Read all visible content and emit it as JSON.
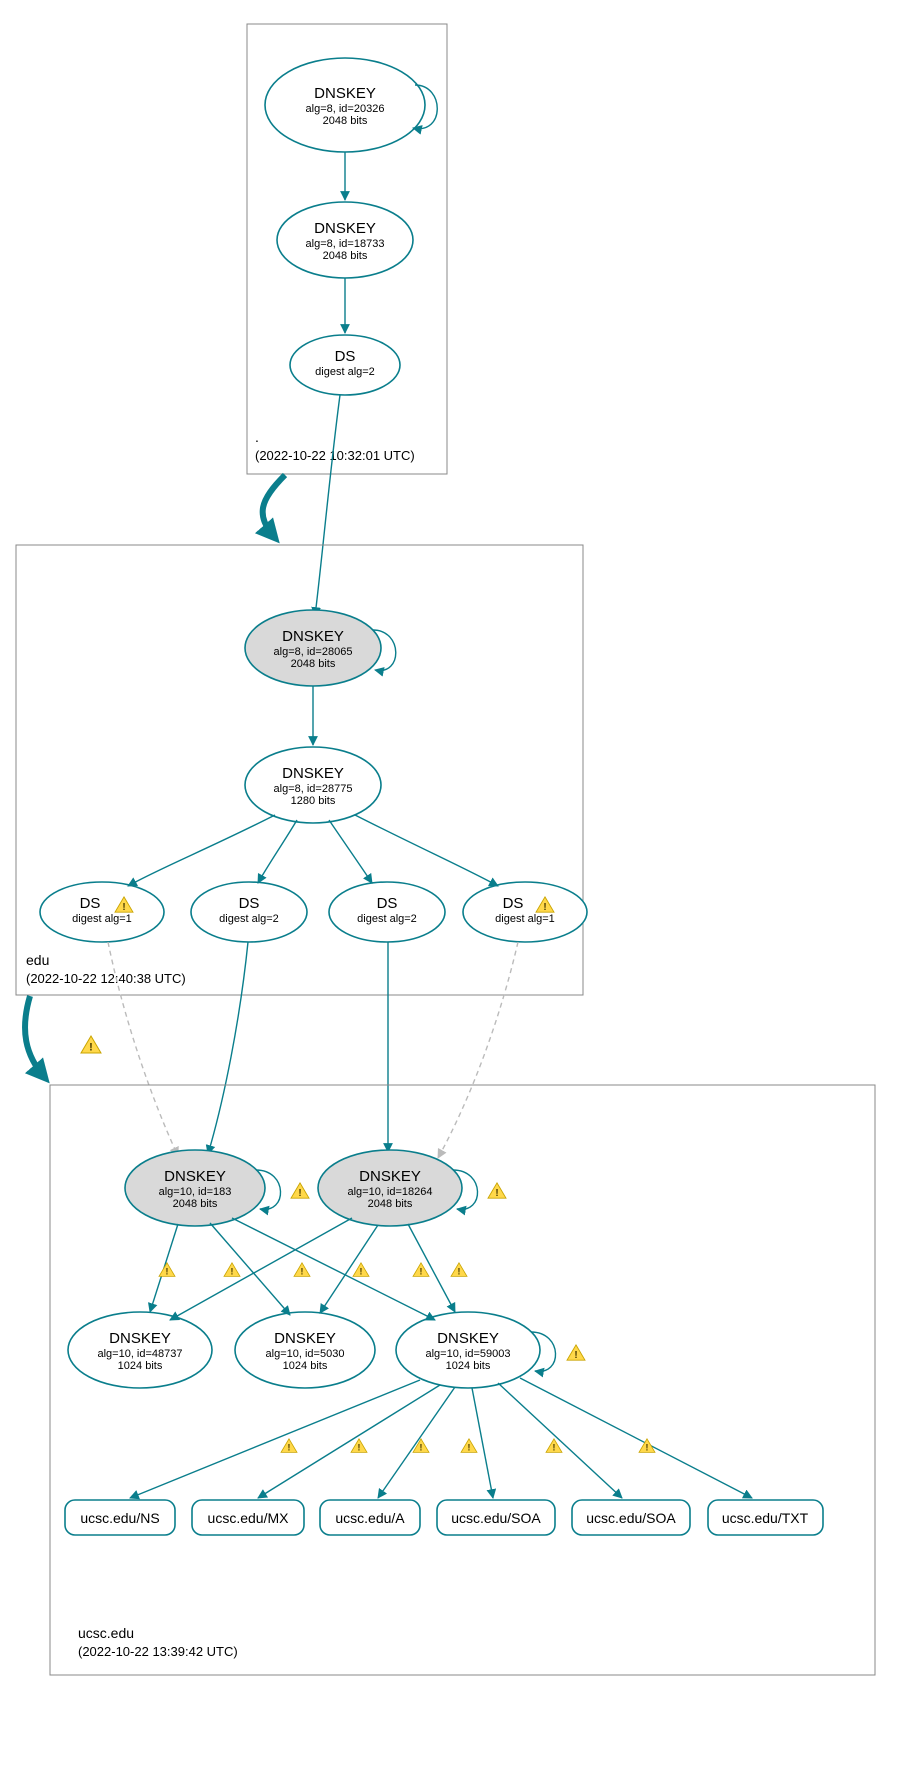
{
  "chart_data": {
    "type": "dnssec-auth-graph",
    "zones": [
      {
        "id": "root",
        "label": ".",
        "timestamp": "(2022-10-22 10:32:01 UTC)"
      },
      {
        "id": "edu",
        "label": "edu",
        "timestamp": "(2022-10-22 12:40:38 UTC)"
      },
      {
        "id": "ucsc",
        "label": "ucsc.edu",
        "timestamp": "(2022-10-22 13:39:42 UTC)"
      }
    ],
    "nodes": {
      "root_ksk": {
        "title": "DNSKEY",
        "line1": "alg=8, id=20326",
        "line2": "2048 bits"
      },
      "root_zsk": {
        "title": "DNSKEY",
        "line1": "alg=8, id=18733",
        "line2": "2048 bits"
      },
      "root_ds": {
        "title": "DS",
        "line1": "digest alg=2",
        "line2": ""
      },
      "edu_ksk": {
        "title": "DNSKEY",
        "line1": "alg=8, id=28065",
        "line2": "2048 bits"
      },
      "edu_zsk": {
        "title": "DNSKEY",
        "line1": "alg=8, id=28775",
        "line2": "1280 bits"
      },
      "edu_ds1": {
        "title": "DS",
        "line1": "digest alg=1",
        "line2": ""
      },
      "edu_ds2": {
        "title": "DS",
        "line1": "digest alg=2",
        "line2": ""
      },
      "edu_ds3": {
        "title": "DS",
        "line1": "digest alg=2",
        "line2": ""
      },
      "edu_ds4": {
        "title": "DS",
        "line1": "digest alg=1",
        "line2": ""
      },
      "ucsc_ksk1": {
        "title": "DNSKEY",
        "line1": "alg=10, id=183",
        "line2": "2048 bits"
      },
      "ucsc_ksk2": {
        "title": "DNSKEY",
        "line1": "alg=10, id=18264",
        "line2": "2048 bits"
      },
      "ucsc_zsk1": {
        "title": "DNSKEY",
        "line1": "alg=10, id=48737",
        "line2": "1024 bits"
      },
      "ucsc_zsk2": {
        "title": "DNSKEY",
        "line1": "alg=10, id=5030",
        "line2": "1024 bits"
      },
      "ucsc_zsk3": {
        "title": "DNSKEY",
        "line1": "alg=10, id=59003",
        "line2": "1024 bits"
      },
      "rr_ns": {
        "label": "ucsc.edu/NS"
      },
      "rr_mx": {
        "label": "ucsc.edu/MX"
      },
      "rr_a": {
        "label": "ucsc.edu/A"
      },
      "rr_soa1": {
        "label": "ucsc.edu/SOA"
      },
      "rr_soa2": {
        "label": "ucsc.edu/SOA"
      },
      "rr_txt": {
        "label": "ucsc.edu/TXT"
      }
    }
  }
}
